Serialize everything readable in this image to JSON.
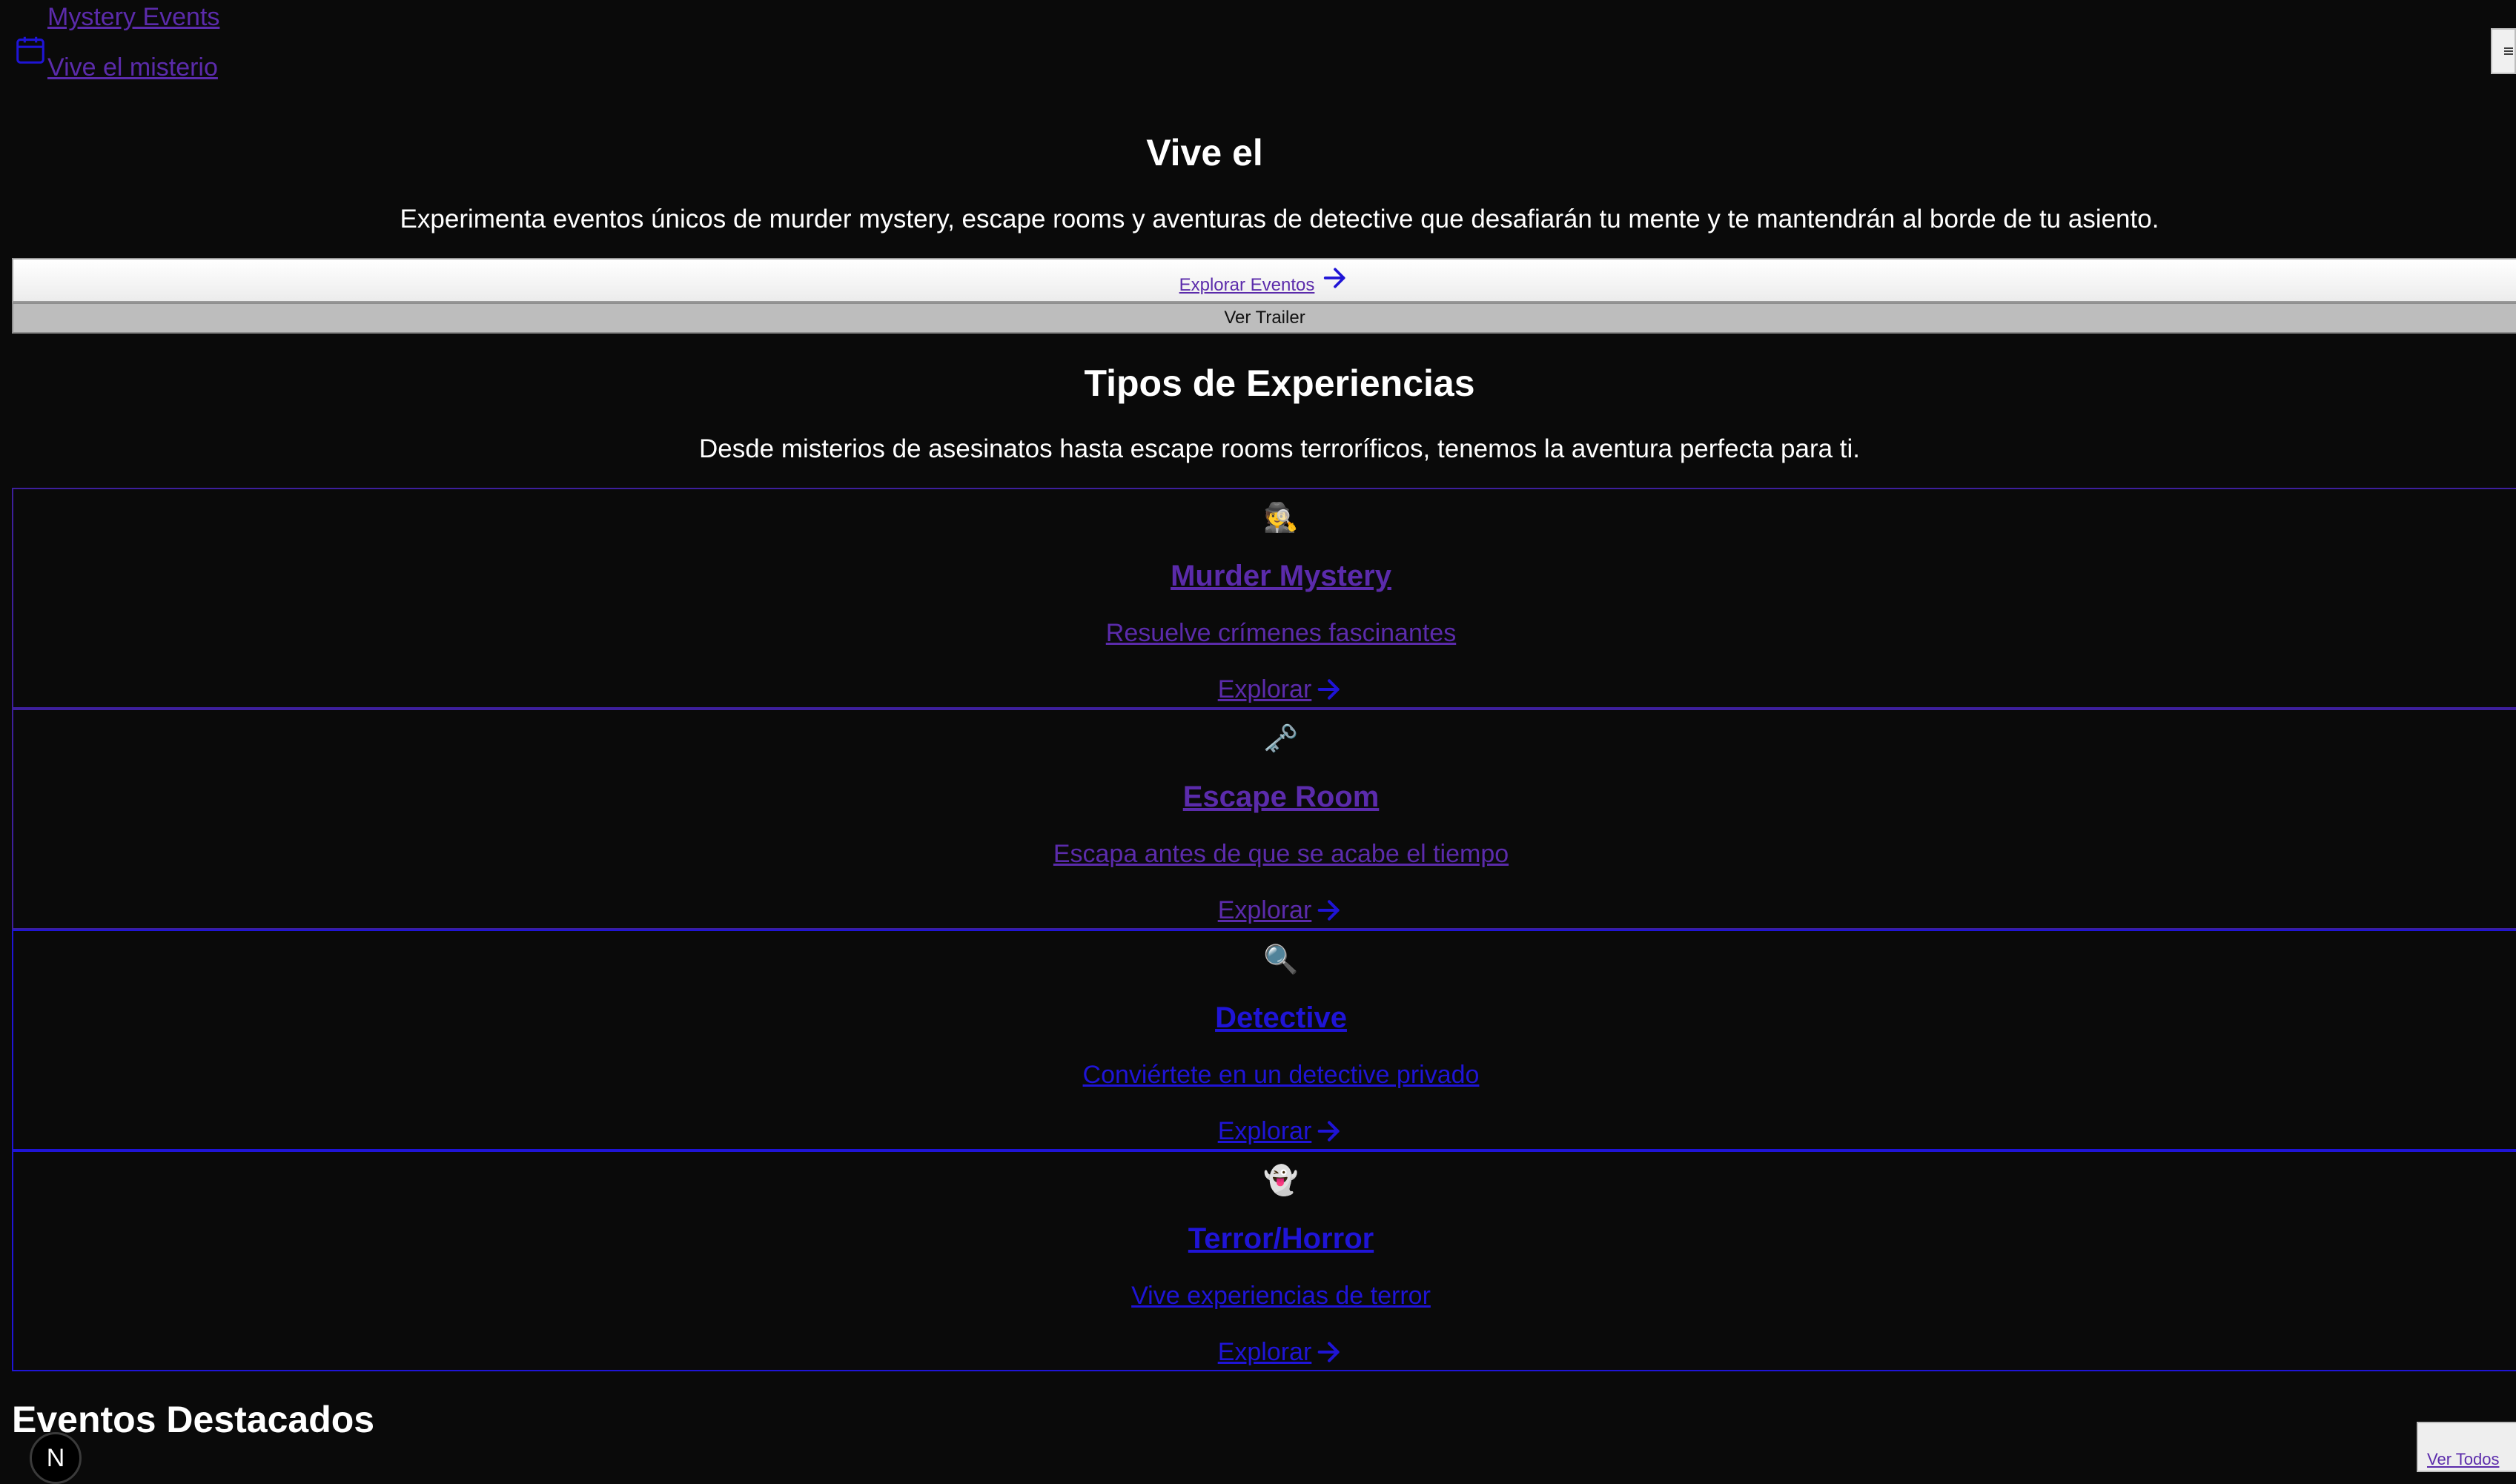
{
  "header": {
    "brand_name": "Mystery Events",
    "brand_tagline": "Vive el misterio",
    "brand_icon": "calendar-icon",
    "menu_icon": "menu-icon"
  },
  "hero": {
    "title": "Vive el",
    "description": "Experimenta eventos únicos de murder mystery, escape rooms y aventuras de detective que desafiarán tu mente y te mantendrán al borde de tu asiento.",
    "explore_label": "Explorar Eventos",
    "trailer_label": "Ver Trailer"
  },
  "experiences": {
    "title": "Tipos de Experiencias",
    "description": "Desde misterios de asesinatos hasta escape rooms terroríficos, tenemos la aventura perfecta para ti.",
    "cards": [
      {
        "icon": "🕵️",
        "icon_name": "detective-icon",
        "title": "Murder Mystery",
        "description": "Resuelve crímenes fascinantes",
        "link": "Explorar"
      },
      {
        "icon": "🗝️",
        "icon_name": "key-icon",
        "title": "Escape Room",
        "description": "Escapa antes de que se acabe el tiempo",
        "link": "Explorar"
      },
      {
        "icon": "🔍",
        "icon_name": "magnifier-icon",
        "title": "Detective",
        "description": "Conviértete en un detective privado",
        "link": "Explorar"
      },
      {
        "icon": "👻",
        "icon_name": "ghost-icon",
        "title": "Terror/Horror",
        "description": "Vive experiencias de terror",
        "link": "Explorar"
      }
    ]
  },
  "featured": {
    "title": "Eventos Destacados",
    "view_all_label": "Ver Todos"
  },
  "dev_badge": {
    "label": "N"
  },
  "colors": {
    "background": "#0a0a0a",
    "visited_link": "#5b2bab",
    "link": "#1f14d6"
  }
}
